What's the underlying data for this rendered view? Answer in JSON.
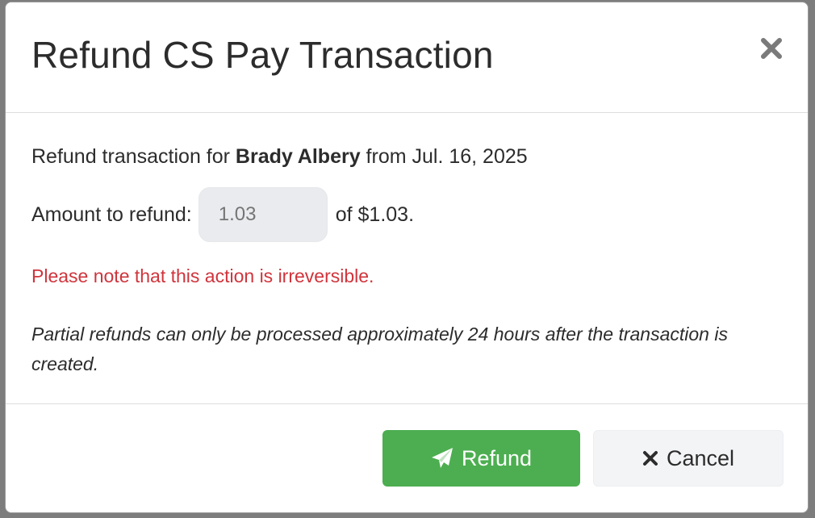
{
  "modal": {
    "title": "Refund CS Pay Transaction",
    "close_icon": "close-icon",
    "body": {
      "intro_prefix": "Refund transaction for ",
      "patient_name": "Brady Albery",
      "intro_suffix": " from Jul. 16, 2025",
      "amount_label": "Amount to refund:",
      "amount_value": "1.03",
      "amount_total": "of $1.03.",
      "warning": "Please note that this action is irreversible.",
      "note": "Partial refunds can only be processed approximately 24 hours after the transaction is created."
    },
    "footer": {
      "refund_label": "Refund",
      "refund_icon": "paper-plane-icon",
      "cancel_label": "Cancel",
      "cancel_icon": "x-icon"
    }
  },
  "colors": {
    "refund_button": "#4cae50",
    "warning_text": "#d0343c",
    "cancel_button": "#f3f4f6"
  }
}
